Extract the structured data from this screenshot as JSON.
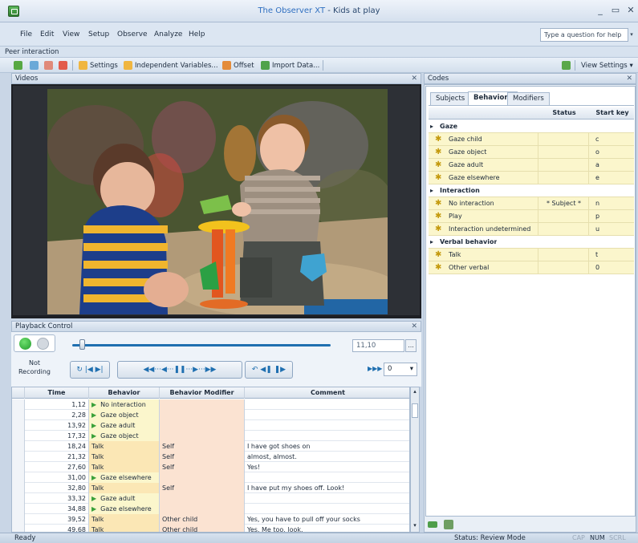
{
  "window": {
    "app_name": "The Observer XT",
    "separator": " - ",
    "document": "Kids at play",
    "minimize": "_",
    "restore": "▭",
    "close": "✕"
  },
  "menu": [
    "File",
    "Edit",
    "View",
    "Setup",
    "Observe",
    "Analyze",
    "Help"
  ],
  "help_box": {
    "placeholder": "Type a question for help",
    "arrow": "▾"
  },
  "context_bar": {
    "label": "Peer interaction"
  },
  "toolbar": {
    "settings": "Settings",
    "independent_variables": "Independent Variables...",
    "offset": "Offset",
    "import_data": "Import Data...",
    "view_settings": "View Settings",
    "view_settings_arrow": "▾",
    "icons": [
      "add-observation-icon",
      "add-event-log-icon",
      "edit-icon",
      "delete-icon",
      "settings-icon",
      "independent-variables-icon",
      "offset-icon",
      "import-data-icon",
      "export-icon"
    ]
  },
  "videos_panel": {
    "title": "Videos",
    "close": "✕"
  },
  "playback_panel": {
    "title": "Playback Control",
    "close": "✕",
    "recording_status": "Not Recording",
    "time": "11,10",
    "browse": "...",
    "speed": "0",
    "speed_arrow": "▾",
    "position_fraction": 0.04,
    "buttons": {
      "group1": "↻ |◀ ▶|",
      "group2": "◀◀···◀···❚❚···▶···▶▶",
      "group3": "↶ ◀❚ ❚▶",
      "fast_forward": "▶▶▶"
    }
  },
  "event_log": {
    "columns": [
      "Time",
      "Behavior",
      "Behavior Modifier",
      "Comment"
    ],
    "rows": [
      {
        "time": "1,12",
        "behavior": "No interaction",
        "modifier": "",
        "comment": "",
        "kind": "state"
      },
      {
        "time": "2,28",
        "behavior": "Gaze object",
        "modifier": "",
        "comment": "",
        "kind": "state"
      },
      {
        "time": "13,92",
        "behavior": "Gaze adult",
        "modifier": "",
        "comment": "",
        "kind": "state"
      },
      {
        "time": "17,32",
        "behavior": "Gaze object",
        "modifier": "",
        "comment": "",
        "kind": "state"
      },
      {
        "time": "18,24",
        "behavior": "Talk",
        "modifier": "Self",
        "comment": "I have got shoes on",
        "kind": "event"
      },
      {
        "time": "21,32",
        "behavior": "Talk",
        "modifier": "Self",
        "comment": "almost, almost.",
        "kind": "event"
      },
      {
        "time": "27,60",
        "behavior": "Talk",
        "modifier": "Self",
        "comment": "Yes!",
        "kind": "event"
      },
      {
        "time": "31,00",
        "behavior": "Gaze elsewhere",
        "modifier": "",
        "comment": "",
        "kind": "state"
      },
      {
        "time": "32,80",
        "behavior": "Talk",
        "modifier": "Self",
        "comment": "I have put my shoes off. Look!",
        "kind": "event"
      },
      {
        "time": "33,32",
        "behavior": "Gaze adult",
        "modifier": "",
        "comment": "",
        "kind": "state"
      },
      {
        "time": "34,88",
        "behavior": "Gaze elsewhere",
        "modifier": "",
        "comment": "",
        "kind": "state"
      },
      {
        "time": "39,52",
        "behavior": "Talk",
        "modifier": "Other child",
        "comment": "Yes, you have to pull off your socks",
        "kind": "event"
      },
      {
        "time": "49,68",
        "behavior": "Talk",
        "modifier": "Other child",
        "comment": "Yes. Me too, look.",
        "kind": "event"
      }
    ]
  },
  "codes_panel": {
    "title": "Codes",
    "close": "✕",
    "tabs": [
      "Subjects",
      "Behaviors",
      "Modifiers"
    ],
    "active_tab": "Behaviors",
    "columns": [
      "Status",
      "Start key"
    ],
    "groups": [
      {
        "name": "Gaze",
        "items": [
          {
            "label": "Gaze child",
            "status": "",
            "key": "c"
          },
          {
            "label": "Gaze object",
            "status": "",
            "key": "o"
          },
          {
            "label": "Gaze adult",
            "status": "",
            "key": "a"
          },
          {
            "label": "Gaze elsewhere",
            "status": "",
            "key": "e"
          }
        ]
      },
      {
        "name": "Interaction",
        "items": [
          {
            "label": "No interaction",
            "status": "* Subject *",
            "key": "n"
          },
          {
            "label": "Play",
            "status": "",
            "key": "p"
          },
          {
            "label": "Interaction undetermined",
            "status": "",
            "key": "u"
          }
        ]
      },
      {
        "name": "Verbal behavior",
        "items": [
          {
            "label": "Talk",
            "status": "",
            "key": "t"
          },
          {
            "label": "Other verbal",
            "status": "",
            "key": "0"
          }
        ]
      }
    ]
  },
  "status_bar": {
    "left": "Ready",
    "center": "Status: Review Mode",
    "indicators": [
      "CAP",
      "NUM",
      "SCRL"
    ]
  },
  "colors": {
    "accent": "#2f6fc0",
    "state_marker": "#3aa13a",
    "modifier_cell": "#fbe3d2",
    "behavior_row": "#fbf6cc"
  }
}
